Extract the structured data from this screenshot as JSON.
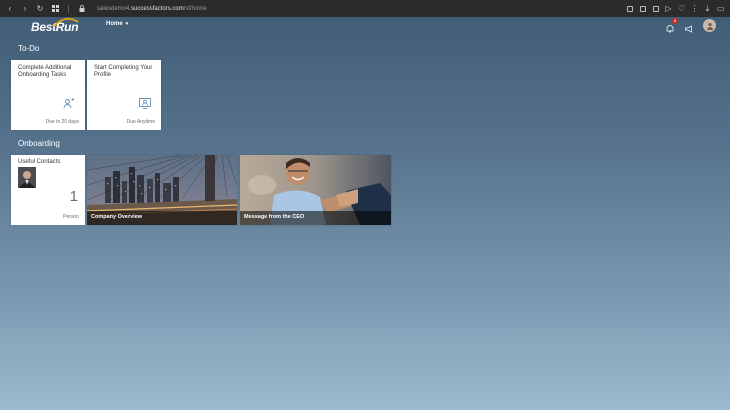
{
  "browser": {
    "url_prefix": "salesdemo4.",
    "url_host": "successfactors.com",
    "url_path": "/sf/home"
  },
  "header": {
    "logo": "BestRun",
    "home_menu": "Home",
    "notification_count": "2"
  },
  "todo": {
    "title": "To-Do",
    "tiles": [
      {
        "title": "Complete Additional Onboarding Tasks",
        "footer": "Due in 20 days",
        "icon": "person-tasks-icon"
      },
      {
        "title": "Start Completing Your Profile",
        "footer": "Due Anytime",
        "icon": "profile-card-icon"
      }
    ]
  },
  "onboarding": {
    "title": "Onboarding",
    "contacts": {
      "title": "Useful Contacts",
      "count": "1",
      "unit": "Person"
    },
    "image_tiles": [
      {
        "caption": "Company Overview"
      },
      {
        "caption": "Message from the CEO"
      }
    ]
  },
  "colors": {
    "bg_top": "#3f5a73",
    "bg_bottom": "#9dbbd0",
    "badge": "#d0271d"
  }
}
